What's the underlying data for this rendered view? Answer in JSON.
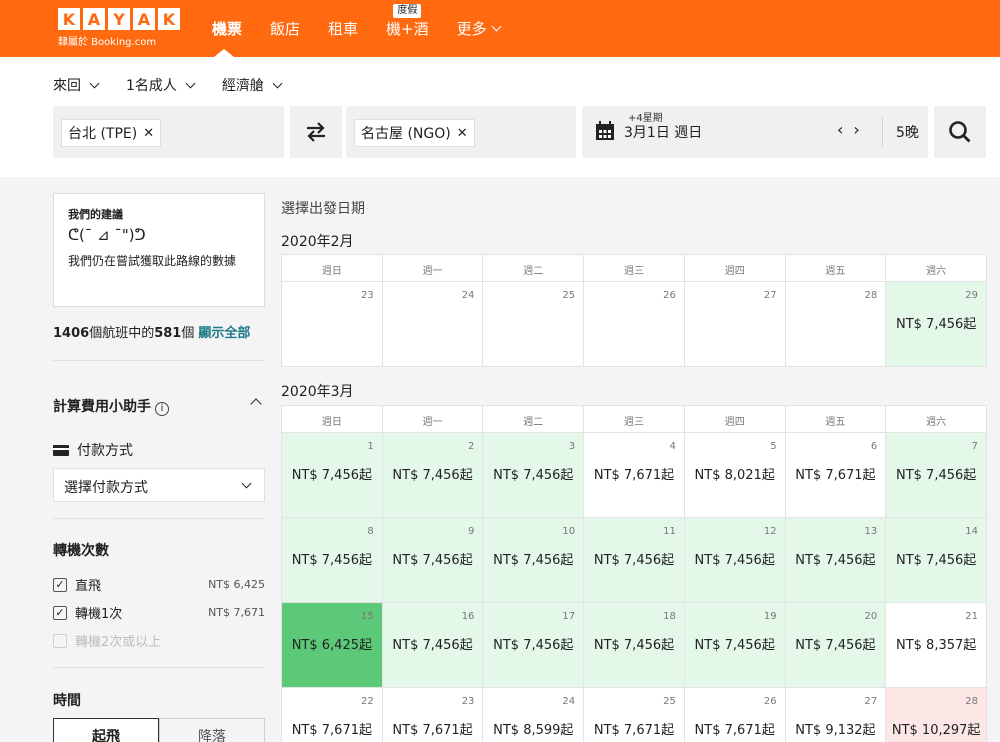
{
  "header": {
    "logo_letters": [
      "K",
      "A",
      "Y",
      "A",
      "K"
    ],
    "logo_sub": "隸屬於 Booking.com",
    "nav": [
      {
        "label": "機票",
        "active": true,
        "badge": ""
      },
      {
        "label": "飯店",
        "active": false,
        "badge": ""
      },
      {
        "label": "租車",
        "active": false,
        "badge": ""
      },
      {
        "label": "機+酒",
        "active": false,
        "badge": "度假"
      },
      {
        "label": "更多",
        "active": false,
        "badge": ""
      }
    ]
  },
  "search": {
    "trip_type": "來回",
    "passengers": "1名成人",
    "cabin": "經濟艙",
    "origin": "台北 (TPE)",
    "destination": "名古屋 (NGO)",
    "date_plus": "+4星期",
    "date": "3月1日  週日",
    "nights": "5晚"
  },
  "left": {
    "rec_title": "我們的建議",
    "rec_face": "ᕦ(¯ ⊿ ¯\")ᕤ",
    "rec_text": "我們仍在嘗試獲取此路線的數據",
    "count_total": "1406",
    "count_mid": "個航班中的",
    "count_shown": "581",
    "count_suffix": "個",
    "show_all": "顯示全部",
    "fee_helper": "計算費用小助手",
    "pay_label": "付款方式",
    "pay_select": "選擇付款方式",
    "stops_title": "轉機次數",
    "stops": [
      {
        "label": "直飛",
        "price": "NT$ 6,425",
        "checked": true,
        "disabled": false
      },
      {
        "label": "轉機1次",
        "price": "NT$ 7,671",
        "checked": true,
        "disabled": false
      },
      {
        "label": "轉機2次或以上",
        "price": "",
        "checked": false,
        "disabled": true
      }
    ],
    "time_title": "時間",
    "time_tabs": [
      "起飛",
      "降落"
    ]
  },
  "calendar": {
    "heading": "選擇出發日期",
    "weekdays": [
      "週日",
      "週一",
      "週二",
      "週三",
      "週四",
      "週五",
      "週六"
    ],
    "months": [
      {
        "title": "2020年2月",
        "days": [
          {
            "day": "23",
            "price": "",
            "tone": "white"
          },
          {
            "day": "24",
            "price": "",
            "tone": "white"
          },
          {
            "day": "25",
            "price": "",
            "tone": "white"
          },
          {
            "day": "26",
            "price": "",
            "tone": "white"
          },
          {
            "day": "27",
            "price": "",
            "tone": "white"
          },
          {
            "day": "28",
            "price": "",
            "tone": "white"
          },
          {
            "day": "29",
            "price": "NT$ 7,456起",
            "tone": "green"
          }
        ]
      },
      {
        "title": "2020年3月",
        "days": [
          {
            "day": "1",
            "price": "NT$ 7,456起",
            "tone": "green"
          },
          {
            "day": "2",
            "price": "NT$ 7,456起",
            "tone": "green"
          },
          {
            "day": "3",
            "price": "NT$ 7,456起",
            "tone": "green"
          },
          {
            "day": "4",
            "price": "NT$ 7,671起",
            "tone": "white"
          },
          {
            "day": "5",
            "price": "NT$ 8,021起",
            "tone": "white"
          },
          {
            "day": "6",
            "price": "NT$ 7,671起",
            "tone": "white"
          },
          {
            "day": "7",
            "price": "NT$ 7,456起",
            "tone": "green"
          },
          {
            "day": "8",
            "price": "NT$ 7,456起",
            "tone": "green"
          },
          {
            "day": "9",
            "price": "NT$ 7,456起",
            "tone": "green"
          },
          {
            "day": "10",
            "price": "NT$ 7,456起",
            "tone": "green"
          },
          {
            "day": "11",
            "price": "NT$ 7,456起",
            "tone": "green"
          },
          {
            "day": "12",
            "price": "NT$ 7,456起",
            "tone": "green"
          },
          {
            "day": "13",
            "price": "NT$ 7,456起",
            "tone": "green"
          },
          {
            "day": "14",
            "price": "NT$ 7,456起",
            "tone": "green"
          },
          {
            "day": "15",
            "price": "NT$ 6,425起",
            "tone": "dark"
          },
          {
            "day": "16",
            "price": "NT$ 7,456起",
            "tone": "green"
          },
          {
            "day": "17",
            "price": "NT$ 7,456起",
            "tone": "green"
          },
          {
            "day": "18",
            "price": "NT$ 7,456起",
            "tone": "green"
          },
          {
            "day": "19",
            "price": "NT$ 7,456起",
            "tone": "green"
          },
          {
            "day": "20",
            "price": "NT$ 7,456起",
            "tone": "green"
          },
          {
            "day": "21",
            "price": "NT$ 8,357起",
            "tone": "white"
          },
          {
            "day": "22",
            "price": "NT$ 7,671起",
            "tone": "white"
          },
          {
            "day": "23",
            "price": "NT$ 7,671起",
            "tone": "white"
          },
          {
            "day": "24",
            "price": "NT$ 8,599起",
            "tone": "white"
          },
          {
            "day": "25",
            "price": "NT$ 7,671起",
            "tone": "white"
          },
          {
            "day": "26",
            "price": "NT$ 7,671起",
            "tone": "white"
          },
          {
            "day": "27",
            "price": "NT$ 9,132起",
            "tone": "white"
          },
          {
            "day": "28",
            "price": "NT$ 10,297起",
            "tone": "pink"
          }
        ]
      }
    ]
  },
  "colors": {
    "brand": "#ff690f",
    "cheap": "#e4f8ea",
    "cheapest": "#5cc979",
    "expensive": "#fce6e6",
    "link": "#1a7a86"
  },
  "icons": [
    "swap-icon",
    "calendar-icon",
    "search-icon",
    "info-icon",
    "card-icon",
    "chevron-down-icon",
    "chevron-left-icon",
    "chevron-right-icon",
    "close-icon"
  ]
}
